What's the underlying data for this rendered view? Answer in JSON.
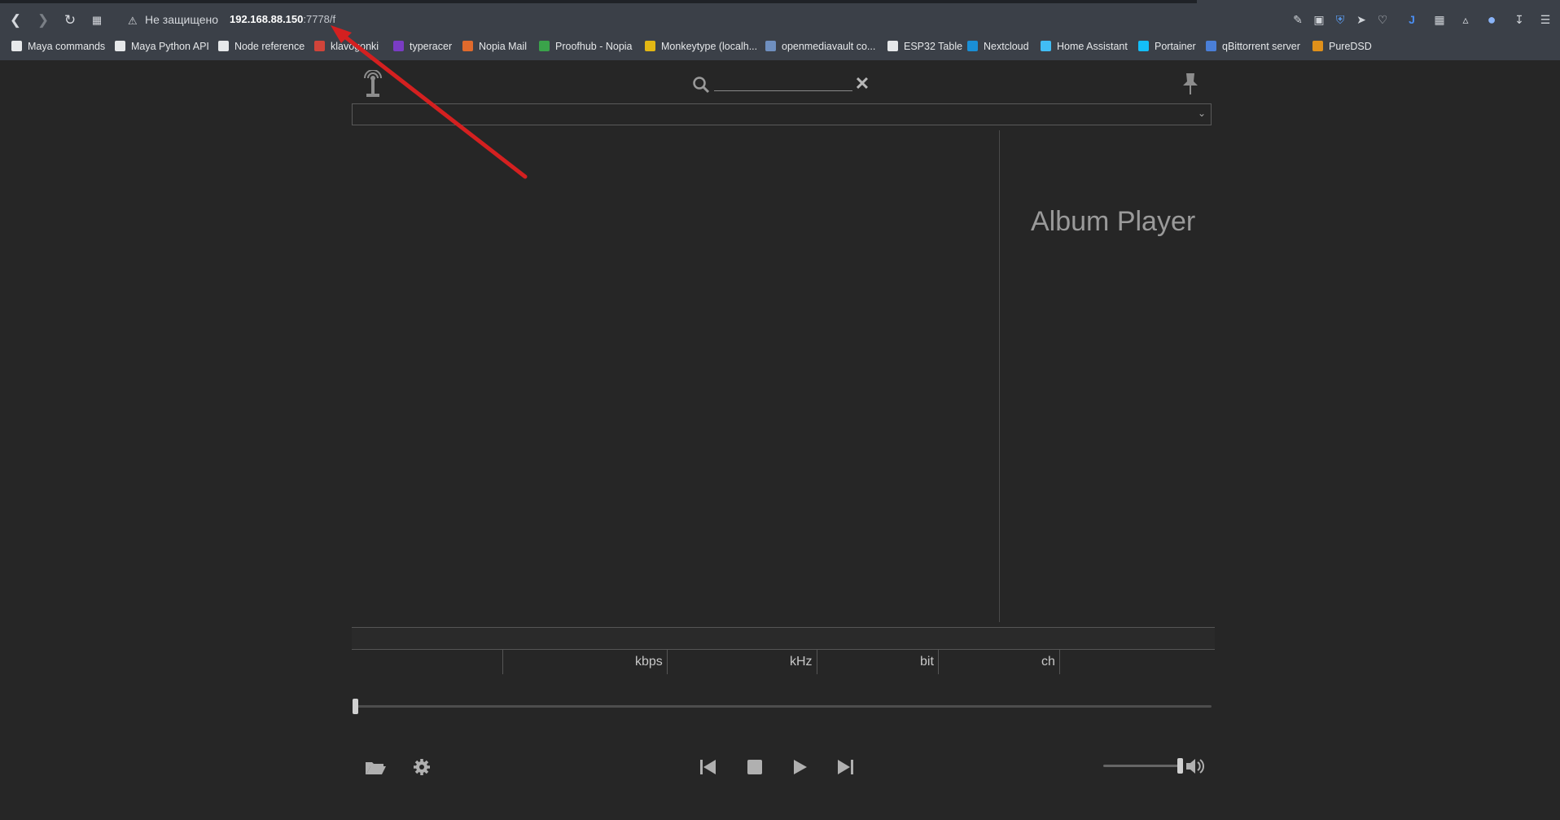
{
  "browser": {
    "security_text": "Не защищено",
    "url_host": "192.168.88.150",
    "url_rest": ":7778/f"
  },
  "bookmarks": [
    {
      "label": "Maya commands",
      "icon": "page-icon",
      "color": "#e6e8ea"
    },
    {
      "label": "Maya Python API",
      "icon": "maya-icon",
      "color": "#e6e8ea"
    },
    {
      "label": "Node reference",
      "icon": "page-icon",
      "color": "#e6e8ea"
    },
    {
      "label": "klavogonki",
      "icon": "car-icon",
      "color": "#d0443a"
    },
    {
      "label": "typeracer",
      "icon": "typeracer-icon",
      "color": "#7a3cc4"
    },
    {
      "label": "Nopia Mail",
      "icon": "nopia-icon",
      "color": "#e06a2c"
    },
    {
      "label": "Proofhub - Nopia",
      "icon": "proofhub-icon",
      "color": "#3aa34a"
    },
    {
      "label": "Monkeytype (localh...",
      "icon": "monkeytype-icon",
      "color": "#e2b714"
    },
    {
      "label": "openmediavault co...",
      "icon": "omv-icon",
      "color": "#6f8fbf"
    },
    {
      "label": "ESP32 Table",
      "icon": "page-icon",
      "color": "#e6e8ea"
    },
    {
      "label": "Nextcloud",
      "icon": "nextcloud-icon",
      "color": "#1a8fd6"
    },
    {
      "label": "Home Assistant",
      "icon": "homeassistant-icon",
      "color": "#41bdf5"
    },
    {
      "label": "Portainer",
      "icon": "portainer-icon",
      "color": "#13bef9"
    },
    {
      "label": "qBittorrent server",
      "icon": "qbittorrent-icon",
      "color": "#4a7fd8"
    },
    {
      "label": "PureDSD",
      "icon": "puredsd-icon",
      "color": "#e0901a"
    }
  ],
  "player": {
    "search_placeholder": "",
    "album_title": "Album Player",
    "stats": {
      "kbps": "kbps",
      "khz": "kHz",
      "bit": "bit",
      "ch": "ch"
    },
    "seek_progress": 0,
    "volume_level": 1
  },
  "annotation": {
    "arrow_color": "#d42020"
  }
}
